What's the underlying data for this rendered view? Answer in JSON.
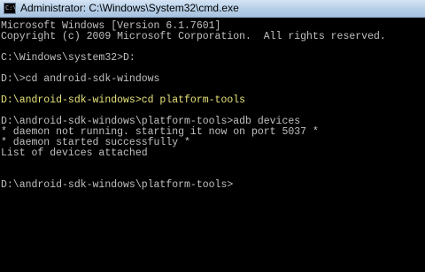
{
  "window": {
    "icon_glyph": "C:\\",
    "title": "Administrator: C:\\Windows\\System32\\cmd.exe"
  },
  "console": {
    "lines": [
      {
        "text": "Microsoft Windows [Version 6.1.7601]",
        "highlight": false
      },
      {
        "text": "Copyright (c) 2009 Microsoft Corporation.  All rights reserved.",
        "highlight": false
      },
      {
        "text": "",
        "highlight": false
      },
      {
        "text": "C:\\Windows\\system32>D:",
        "highlight": false
      },
      {
        "text": "",
        "highlight": false
      },
      {
        "text": "D:\\>cd android-sdk-windows",
        "highlight": false
      },
      {
        "text": "",
        "highlight": false
      },
      {
        "text": "D:\\android-sdk-windows>cd platform-tools",
        "highlight": true
      },
      {
        "text": "",
        "highlight": false
      },
      {
        "text": "D:\\android-sdk-windows\\platform-tools>adb devices",
        "highlight": false
      },
      {
        "text": "* daemon not running. starting it now on port 5037 *",
        "highlight": false
      },
      {
        "text": "* daemon started successfully *",
        "highlight": false
      },
      {
        "text": "List of devices attached",
        "highlight": false
      },
      {
        "text": "",
        "highlight": false
      },
      {
        "text": "",
        "highlight": false
      },
      {
        "text": "D:\\android-sdk-windows\\platform-tools>",
        "highlight": false
      }
    ],
    "text_color": "#c0c0c0",
    "highlight_color": "#e8e47a",
    "background_color": "#000000"
  }
}
